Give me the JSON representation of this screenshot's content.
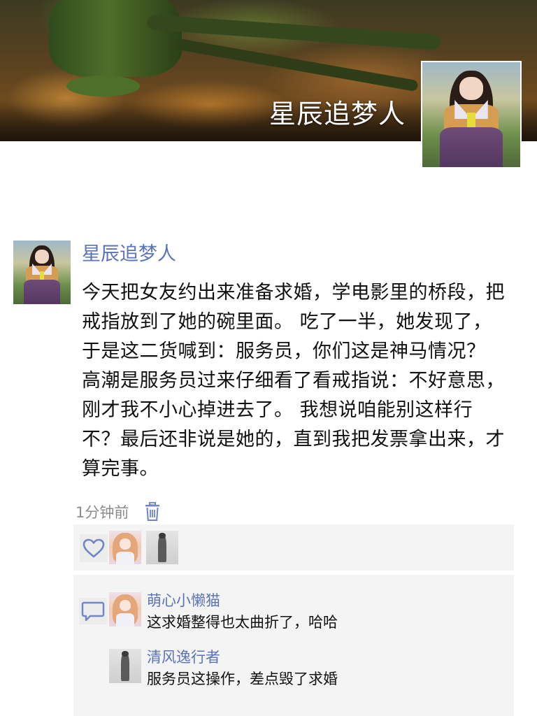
{
  "cover": {
    "title": "星辰追梦人"
  },
  "post": {
    "author": "星辰追梦人",
    "content": "今天把女友约出来准备求婚，学电影里的桥段，把戒指放到了她的碗里面。 吃了一半，她发现了，于是这二货喊到：服务员，你们这是神马情况？ 高潮是服务员过来仔细看了看戒指说：不好意思，刚才我不小心掉进去了。 我想说咱能别这样行不？最后还非说是她的，直到我把发票拿出来，才算完事。",
    "timestamp": "1分钟前"
  },
  "interactions": {
    "likers": [
      "anime-girl-avatar",
      "man-in-suit-avatar"
    ],
    "comments": [
      {
        "name": "萌心小懒猫",
        "text": "这求婚整得也太曲折了，哈哈"
      },
      {
        "name": "清风逸行者",
        "text": "服务员这操作，差点毁了求婚"
      }
    ]
  },
  "colors": {
    "link_blue": "#5b74b8",
    "panel_bg": "#f4f4f4",
    "meta_gray": "#8c8c8c"
  }
}
